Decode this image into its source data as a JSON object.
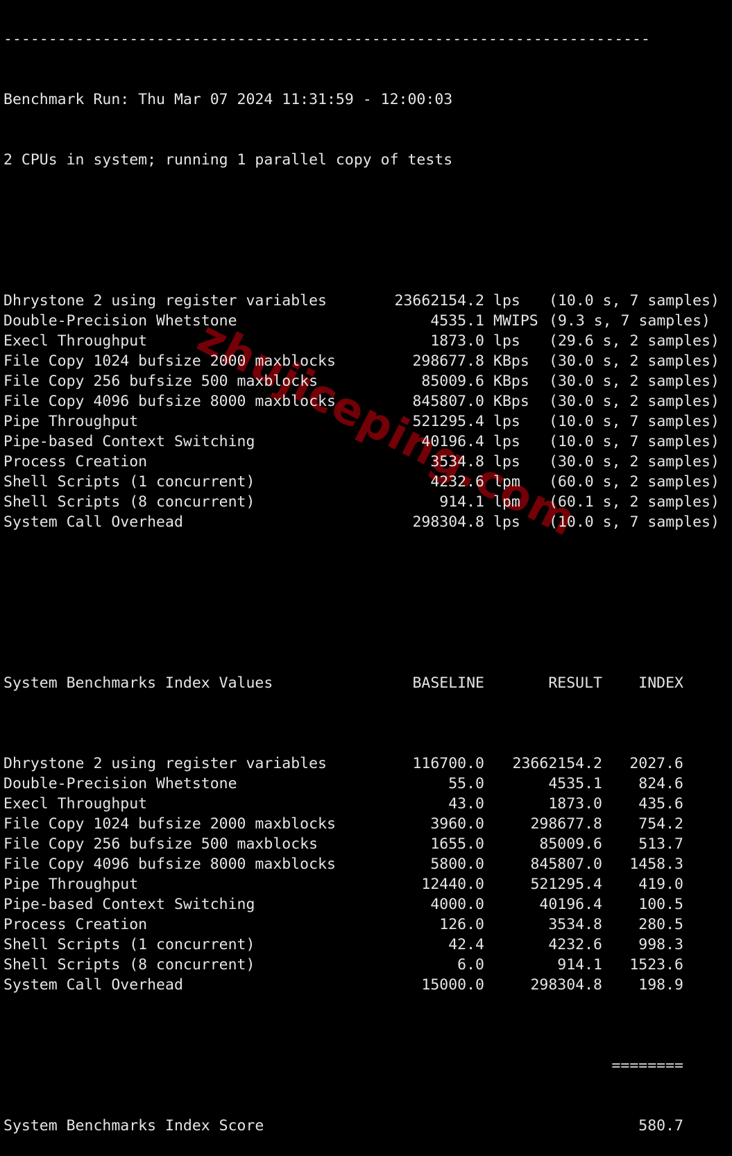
{
  "terminal": {
    "separator": "------------------------------------------------------------------------",
    "header_line": "Benchmark Run: Thu Mar 07 2024 11:31:59 - 12:00:03",
    "cpu_line": "2 CPUs in system; running 1 parallel copy of tests",
    "results": [
      {
        "name": "Dhrystone 2 using register variables",
        "value": "23662154.2",
        "unit": "lps",
        "meta": "(10.0 s, 7 samples)"
      },
      {
        "name": "Double-Precision Whetstone",
        "value": "4535.1",
        "unit": "MWIPS",
        "meta": "(9.3 s, 7 samples)"
      },
      {
        "name": "Execl Throughput",
        "value": "1873.0",
        "unit": "lps",
        "meta": "(29.6 s, 2 samples)"
      },
      {
        "name": "File Copy 1024 bufsize 2000 maxblocks",
        "value": "298677.8",
        "unit": "KBps",
        "meta": "(30.0 s, 2 samples)"
      },
      {
        "name": "File Copy 256 bufsize 500 maxblocks",
        "value": "85009.6",
        "unit": "KBps",
        "meta": "(30.0 s, 2 samples)"
      },
      {
        "name": "File Copy 4096 bufsize 8000 maxblocks",
        "value": "845807.0",
        "unit": "KBps",
        "meta": "(30.0 s, 2 samples)"
      },
      {
        "name": "Pipe Throughput",
        "value": "521295.4",
        "unit": "lps",
        "meta": "(10.0 s, 7 samples)"
      },
      {
        "name": "Pipe-based Context Switching",
        "value": "40196.4",
        "unit": "lps",
        "meta": "(10.0 s, 7 samples)"
      },
      {
        "name": "Process Creation",
        "value": "3534.8",
        "unit": "lps",
        "meta": "(30.0 s, 2 samples)"
      },
      {
        "name": "Shell Scripts (1 concurrent)",
        "value": "4232.6",
        "unit": "lpm",
        "meta": "(60.0 s, 2 samples)"
      },
      {
        "name": "Shell Scripts (8 concurrent)",
        "value": "914.1",
        "unit": "lpm",
        "meta": "(60.1 s, 2 samples)"
      },
      {
        "name": "System Call Overhead",
        "value": "298304.8",
        "unit": "lps",
        "meta": "(10.0 s, 7 samples)"
      }
    ],
    "index_header": {
      "title": "System Benchmarks Index Values",
      "baseline": "BASELINE",
      "result": "RESULT",
      "index": "INDEX"
    },
    "index_rows": [
      {
        "name": "Dhrystone 2 using register variables",
        "baseline": "116700.0",
        "result": "23662154.2",
        "index": "2027.6"
      },
      {
        "name": "Double-Precision Whetstone",
        "baseline": "55.0",
        "result": "4535.1",
        "index": "824.6"
      },
      {
        "name": "Execl Throughput",
        "baseline": "43.0",
        "result": "1873.0",
        "index": "435.6"
      },
      {
        "name": "File Copy 1024 bufsize 2000 maxblocks",
        "baseline": "3960.0",
        "result": "298677.8",
        "index": "754.2"
      },
      {
        "name": "File Copy 256 bufsize 500 maxblocks",
        "baseline": "1655.0",
        "result": "85009.6",
        "index": "513.7"
      },
      {
        "name": "File Copy 4096 bufsize 8000 maxblocks",
        "baseline": "5800.0",
        "result": "845807.0",
        "index": "1458.3"
      },
      {
        "name": "Pipe Throughput",
        "baseline": "12440.0",
        "result": "521295.4",
        "index": "419.0"
      },
      {
        "name": "Pipe-based Context Switching",
        "baseline": "4000.0",
        "result": "40196.4",
        "index": "100.5"
      },
      {
        "name": "Process Creation",
        "baseline": "126.0",
        "result": "3534.8",
        "index": "280.5"
      },
      {
        "name": "Shell Scripts (1 concurrent)",
        "baseline": "42.4",
        "result": "4232.6",
        "index": "998.3"
      },
      {
        "name": "Shell Scripts (8 concurrent)",
        "baseline": "6.0",
        "result": "914.1",
        "index": "1523.6"
      },
      {
        "name": "System Call Overhead",
        "baseline": "15000.0",
        "result": "298304.8",
        "index": "198.9"
      }
    ],
    "score_rule": "========",
    "score_label": "System Benchmarks Index Score",
    "score_value": "580.7"
  },
  "watermark": "zhujiceping.com",
  "colors": {
    "background": "#000000",
    "text": "#e6e6e6",
    "watermark": "#7a0008"
  }
}
